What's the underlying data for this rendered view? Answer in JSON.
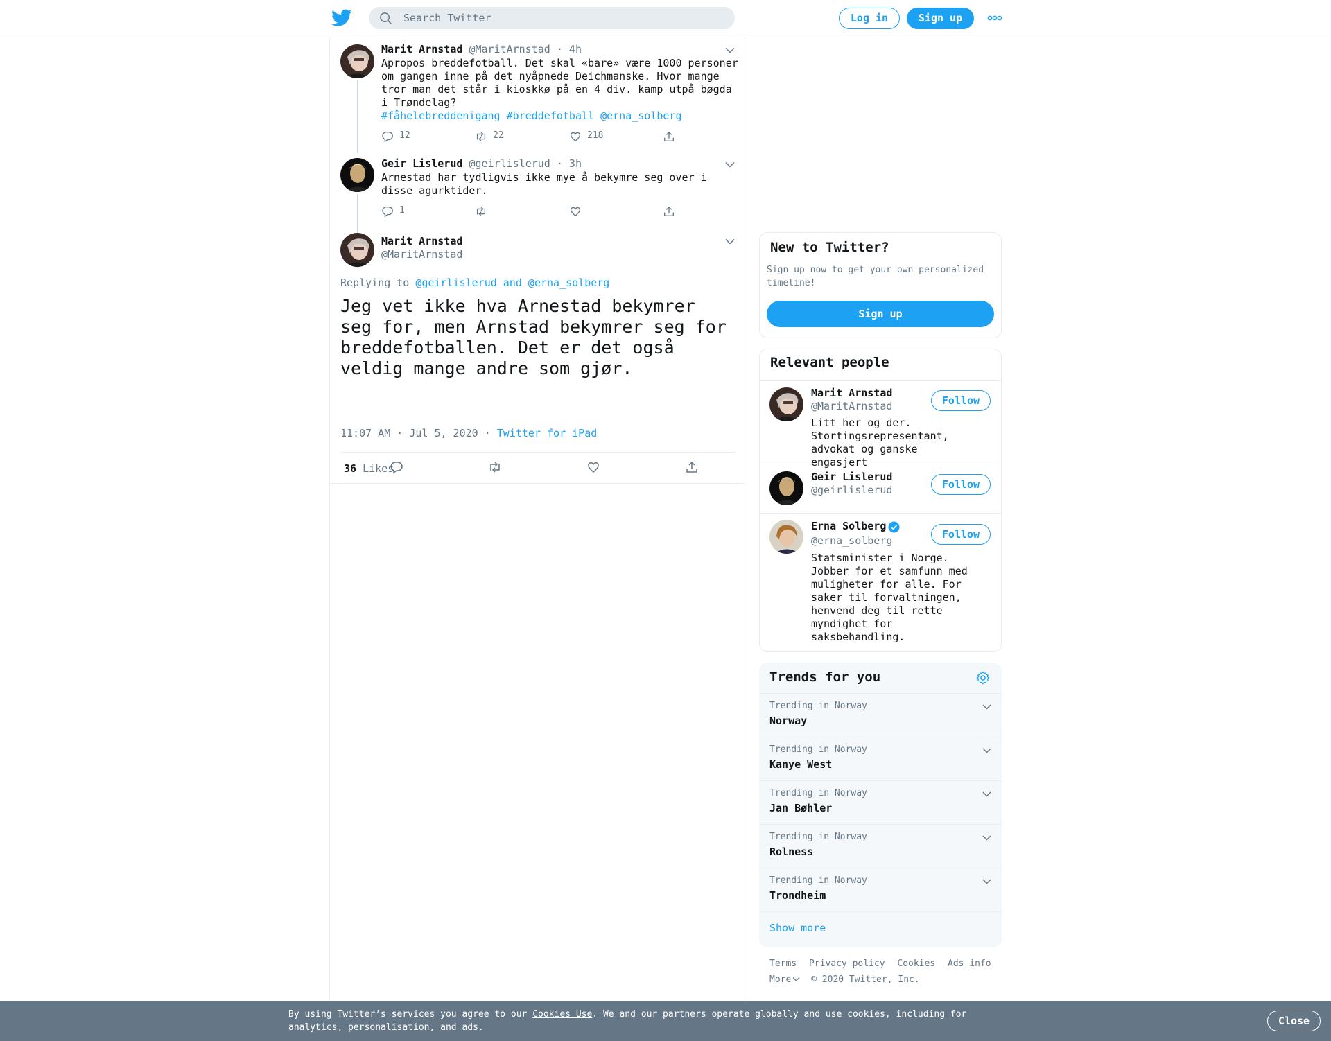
{
  "header": {
    "search_placeholder": "Search Twitter",
    "login_label": "Log in",
    "signup_label": "Sign up"
  },
  "thread": [
    {
      "name": "Marit Arnstad",
      "handle": "@MaritArnstad",
      "time": "· 4h",
      "text": "Apropos breddefotball. Det skal «bare» være 1000 personer om gangen inne på det nyåpnede Deichmanske. Hvor mange tror man det står i kioskkø på en 4 div. kamp utpå bøgda i Trøndelag?",
      "links": "#fåhelebreddenigang #breddefotball @erna_solberg",
      "replies": "12",
      "retweets": "22",
      "likes": "218"
    },
    {
      "name": "Geir Lislerud",
      "handle": "@geirlislerud",
      "time": "· 3h",
      "text": "Arnestad har tydligvis ikke mye å bekymre seg over i disse agurktider.",
      "replies": "1"
    }
  ],
  "main_tweet": {
    "name": "Marit Arnstad",
    "handle": "@MaritArnstad",
    "replying_prefix": "Replying to",
    "replying_to": "@geirlislerud and @erna_solberg",
    "text": "Jeg vet ikke hva Arnestad bekymrer seg for, men Arnstad bekymrer seg for breddefotballen. Det er det også veldig mange andre som gjør.",
    "timestamp": "11:07 AM · Jul 5, 2020",
    "dot": "·",
    "source": "Twitter for iPad",
    "likes_count": "36",
    "likes_label": "Likes"
  },
  "new_to_twitter": {
    "title": "New to Twitter?",
    "subtitle": "Sign up now to get your own personalized timeline!",
    "button": "Sign up"
  },
  "relevant_people": {
    "title": "Relevant people",
    "follow_label": "Follow",
    "people": [
      {
        "name": "Marit Arnstad",
        "handle": "@MaritArnstad",
        "bio": "Litt her og der. Stortingsrepresentant, advokat og ganske engasjert"
      },
      {
        "name": "Geir Lislerud",
        "handle": "@geirlislerud",
        "bio": ""
      },
      {
        "name": "Erna Solberg",
        "handle": "@erna_solberg",
        "bio": "Statsminister i Norge. Jobber for et samfunn med muligheter for alle. For saker til forvaltningen, henvend deg til rette myndighet for saksbehandling."
      }
    ]
  },
  "trends": {
    "title": "Trends for you",
    "items": [
      {
        "context": "Trending in Norway",
        "name": "Norway"
      },
      {
        "context": "Trending in Norway",
        "name": "Kanye West"
      },
      {
        "context": "Trending in Norway",
        "name": "Jan Bøhler"
      },
      {
        "context": "Trending in Norway",
        "name": "Rolness"
      },
      {
        "context": "Trending in Norway",
        "name": "Trondheim"
      }
    ],
    "show_more": "Show more"
  },
  "footer": {
    "links": [
      "Terms",
      "Privacy policy",
      "Cookies",
      "Ads info"
    ],
    "more": "More",
    "copyright": "© 2020 Twitter, Inc."
  },
  "cookie_bar": {
    "text_before": "By using Twitter’s services you agree to our ",
    "link": "Cookies Use",
    "text_after": ". We and our partners operate globally and use cookies, including for analytics, personalisation, and ads.",
    "close": "Close"
  },
  "colors": {
    "accent": "#1da1f2",
    "secondary_text": "#657786",
    "border": "#e6ecf0",
    "cookie_bg": "#657786"
  }
}
